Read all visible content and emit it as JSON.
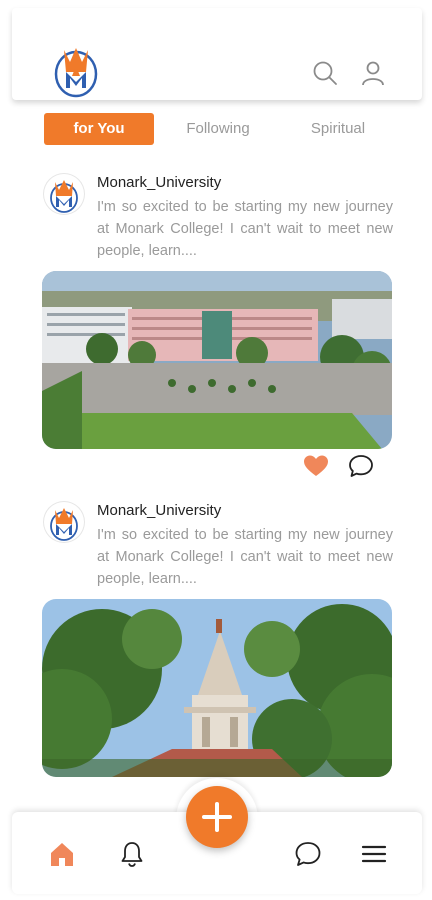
{
  "header": {
    "logo_icon": "monark-university-logo",
    "search_icon": "search-icon",
    "profile_icon": "user-icon"
  },
  "tabs": [
    {
      "label": "for You",
      "active": true
    },
    {
      "label": "Following",
      "active": false
    },
    {
      "label": "Spiritual",
      "active": false
    }
  ],
  "posts": [
    {
      "username": "Monark_University",
      "text": "I'm so excited to be starting my new journey at Monark College! I can't wait to meet new people, learn....",
      "image": "campus-aerial-photo",
      "liked": true
    },
    {
      "username": "Monark_University",
      "text": "I'm so excited to be starting my new journey at Monark College! I can't wait to meet new people, learn....",
      "image": "temple-aerial-photo",
      "liked": true
    }
  ],
  "bottom_nav": {
    "items": [
      "home-icon",
      "bell-icon",
      "chat-icon",
      "menu-icon"
    ],
    "fab": "plus-icon"
  },
  "colors": {
    "accent": "#f07a2a",
    "muted_text": "#9a9a9a",
    "heart": "#f0875a"
  }
}
